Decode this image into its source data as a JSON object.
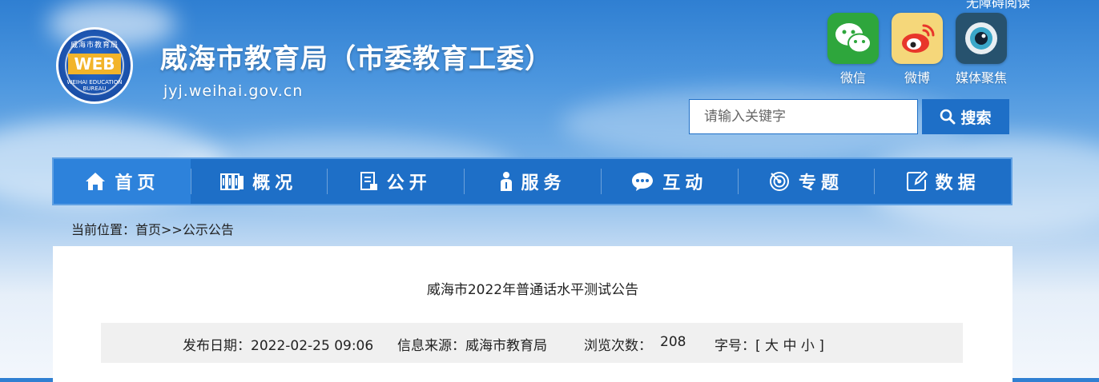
{
  "header": {
    "top_text": "无障碍阅读",
    "site_title": "威海市教育局（市委教育工委）",
    "site_domain": "jyj.weihai.gov.cn",
    "logo": {
      "text_web": "WEB",
      "text_cn": "威海市教育局",
      "text_en": "WEIHAI EDUCATION BUREAU",
      "icon": "web-logo-icon"
    }
  },
  "social": [
    {
      "label": "微信",
      "icon": "wechat-icon",
      "color": "#2ea63c"
    },
    {
      "label": "微博",
      "icon": "weibo-icon",
      "color": "#e8362a"
    },
    {
      "label": "媒体聚焦",
      "icon": "camera-lens-icon",
      "color": "#27526e"
    }
  ],
  "search": {
    "placeholder": "请输入关键字",
    "value": "",
    "button_label": "搜索",
    "button_icon": "search-icon"
  },
  "nav": {
    "items": [
      {
        "label": "首页",
        "icon": "home-icon",
        "active": true
      },
      {
        "label": "概况",
        "icon": "books-icon"
      },
      {
        "label": "公开",
        "icon": "document-icon"
      },
      {
        "label": "服务",
        "icon": "person-icon"
      },
      {
        "label": "互动",
        "icon": "chat-bubble-icon"
      },
      {
        "label": "专题",
        "icon": "target-icon"
      },
      {
        "label": "数据",
        "icon": "edit-icon"
      }
    ],
    "color": "#1e6fc7"
  },
  "breadcrumb": "当前位置：首页>>公示公告",
  "article": {
    "title": "威海市2022年普通话水平测试公告",
    "meta": {
      "publish_date": "发布日期：2022-02-25 09:06",
      "source": "信息来源：威海市教育局",
      "views_label": "浏览次数：",
      "views": "208",
      "font_size": "字号：[ 大 中 小 ]"
    }
  }
}
